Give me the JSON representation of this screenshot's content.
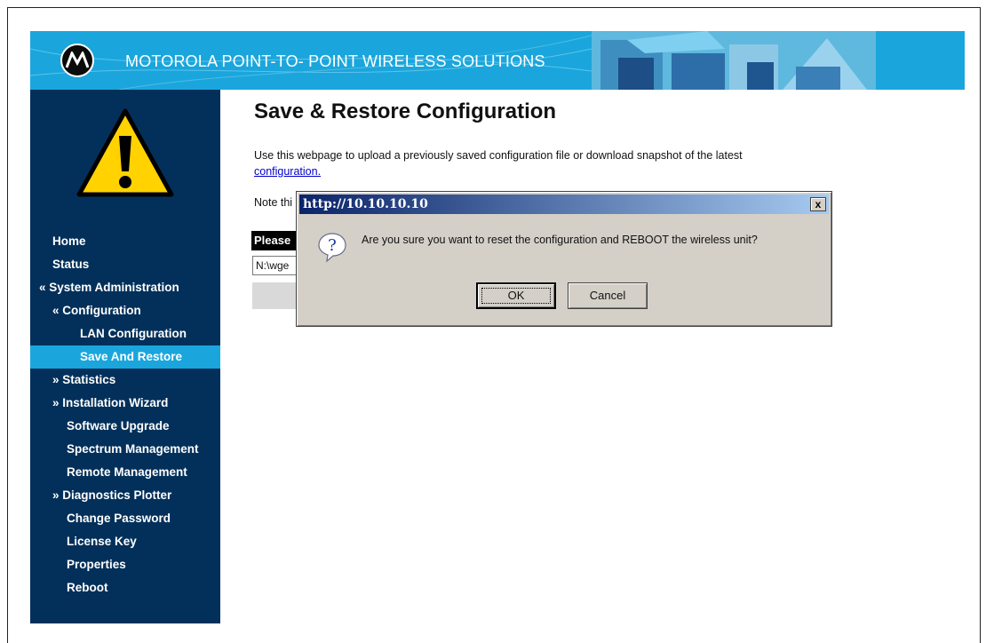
{
  "header": {
    "title": "MOTOROLA POINT-TO- POINT WIRELESS SOLUTIONS",
    "logo_icon": "motorola-logo",
    "background_color": "#1aa6dc"
  },
  "sidebar": {
    "background_color": "#03305a",
    "active_color": "#1aa6dc",
    "warning_icon": "warning-triangle-icon",
    "items": [
      {
        "label": "Home"
      },
      {
        "label": "Status"
      },
      {
        "label": "« System Administration"
      },
      {
        "label": "« Configuration"
      },
      {
        "label": "LAN Configuration"
      },
      {
        "label": "Save And Restore",
        "active": true
      },
      {
        "label": "» Statistics"
      },
      {
        "label": "» Installation Wizard"
      },
      {
        "label": "Software Upgrade"
      },
      {
        "label": "Spectrum Management"
      },
      {
        "label": "Remote Management"
      },
      {
        "label": "» Diagnostics Plotter"
      },
      {
        "label": "Change Password"
      },
      {
        "label": "License Key"
      },
      {
        "label": "Properties"
      },
      {
        "label": "Reboot"
      }
    ]
  },
  "main": {
    "page_title": "Save & Restore Configuration",
    "description": "Use this webpage to upload a previously saved configuration file or download snapshot of the latest",
    "description_link": "configuration.",
    "note_partial": "Note thi",
    "please_partial": "Please",
    "file_input_value": "N:\\wge"
  },
  "dialog": {
    "title": "http://10.10.10.10",
    "close_label": "x",
    "message": "Are you sure you want to reset the configuration and REBOOT the wireless unit?",
    "icon": "question-icon",
    "ok_label": "OK",
    "cancel_label": "Cancel"
  }
}
